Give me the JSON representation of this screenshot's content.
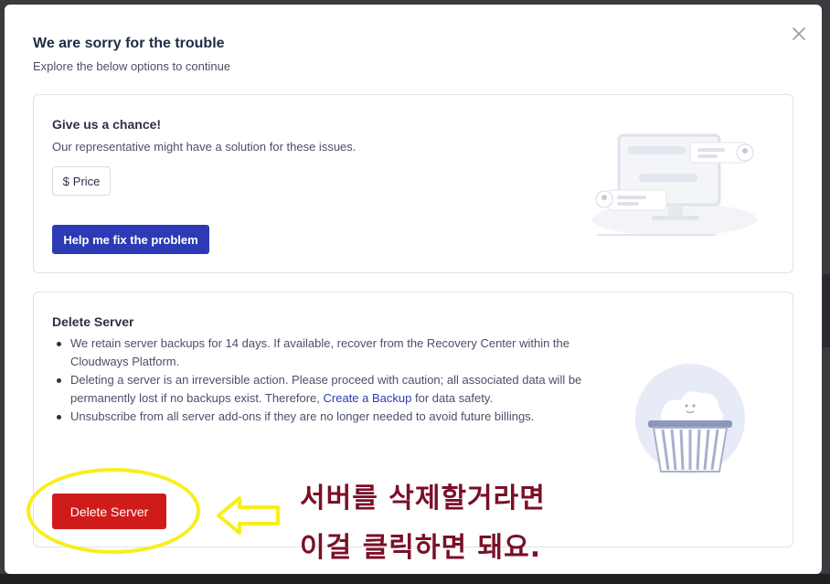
{
  "modal": {
    "title": "We are sorry for the trouble",
    "subtitle": "Explore the below options to continue",
    "close_icon": "close-icon"
  },
  "chance_card": {
    "heading": "Give us a chance!",
    "text": "Our representative might have a solution for these issues.",
    "price_chip": {
      "icon": "$",
      "label": "Price"
    },
    "help_button_label": "Help me fix the problem",
    "illustration": "support-monitor-illustration"
  },
  "delete_card": {
    "heading": "Delete Server",
    "bullet1": "We retain server backups for 14 days. If available, recover from the Recovery Center within the Cloudways Platform.",
    "bullet2_before": "Deleting a server is an irreversible action. Please proceed with caution; all associated data will be permanently lost if no backups exist. Therefore, ",
    "bullet2_link": "Create a Backup",
    "bullet2_after": " for data safety.",
    "bullet3": "Unsubscribe from all server add-ons if they are no longer needed to avoid future billings.",
    "delete_button_label": "Delete Server",
    "illustration": "trash-bin-illustration"
  },
  "annotation": {
    "line1": "서버를 삭제할거라면",
    "line2": "이걸 클릭하면 돼요.",
    "text_color": "#7a1028",
    "highlight_color": "#f7ef1a"
  },
  "colors": {
    "primary": "#2c3bb5",
    "danger": "#d01b1b"
  }
}
